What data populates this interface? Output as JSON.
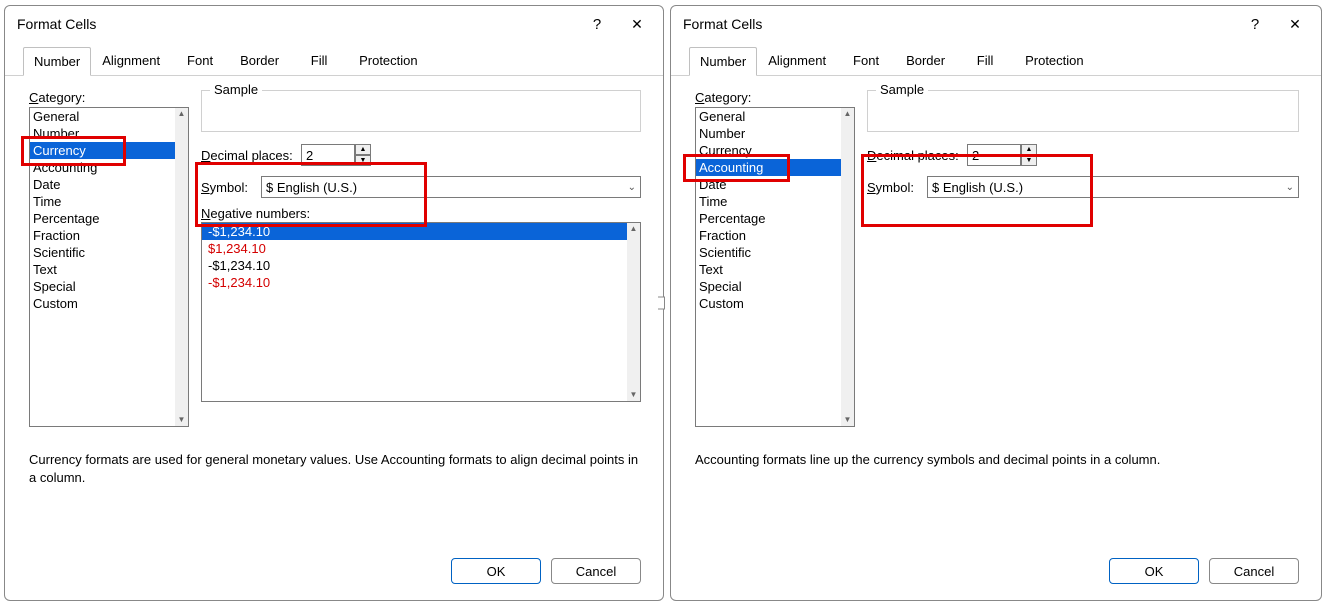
{
  "dialog_title": "Format Cells",
  "help_glyph": "?",
  "close_glyph": "✕",
  "tabs": {
    "number": "Number",
    "alignment": "Alignment",
    "font": "Font",
    "border": "Border",
    "fill": "Fill",
    "protection": "Protection"
  },
  "category_label": "Category:",
  "categories": [
    "General",
    "Number",
    "Currency",
    "Accounting",
    "Date",
    "Time",
    "Percentage",
    "Fraction",
    "Scientific",
    "Text",
    "Special",
    "Custom"
  ],
  "sample_label": "Sample",
  "decimal_label": "Decimal places:",
  "decimal_value": "2",
  "symbol_label": "Symbol:",
  "symbol_value": "$ English (U.S.)",
  "neg_label": "Negative numbers:",
  "neg_items": [
    "-$1,234.10",
    "$1,234.10",
    "-$1,234.10",
    "-$1,234.10"
  ],
  "desc_left": "Currency formats are used for general monetary values.  Use Accounting formats to align decimal points in a column.",
  "desc_right": "Accounting formats line up the currency symbols and decimal points in a column.",
  "ok": "OK",
  "cancel": "Cancel",
  "arrow_up": "▲",
  "arrow_down": "▼",
  "chev_down": "⌄"
}
